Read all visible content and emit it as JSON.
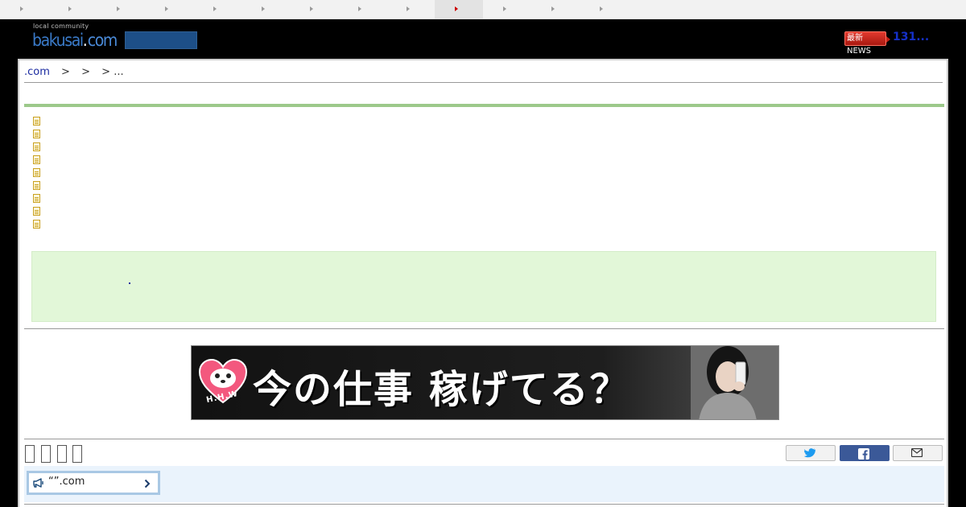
{
  "topnav": {
    "tab_count": 13,
    "active_index": 9,
    "active_color": "#cc0000"
  },
  "header": {
    "logo_tagline": "local community",
    "logo_text": "bakusai",
    "logo_dot": ".",
    "logo_suffix": "com",
    "news_badge": "最新NEWS",
    "news_count": "131..."
  },
  "breadcrumb": {
    "home": ".com",
    "sep1": ">",
    "sep2": ">",
    "sep3": ">",
    "tail": "..."
  },
  "thread_list": {
    "item_count": 9
  },
  "banner": {
    "logo_text": "H.H.W",
    "headline": "今の仕事 稼げてる？"
  },
  "share": {
    "twitter_icon": "twitter-icon",
    "facebook_icon": "facebook-icon",
    "mail_icon": "mail-icon"
  },
  "notice": {
    "label": "“”.com",
    "icon": "megaphone-icon"
  },
  "colors": {
    "accent_green": "#9cc98a",
    "info_green": "#e2f7d8",
    "link_blue": "#1a2aa0",
    "facebook_blue": "#3b5998",
    "notice_bg": "#eaf3fc"
  }
}
